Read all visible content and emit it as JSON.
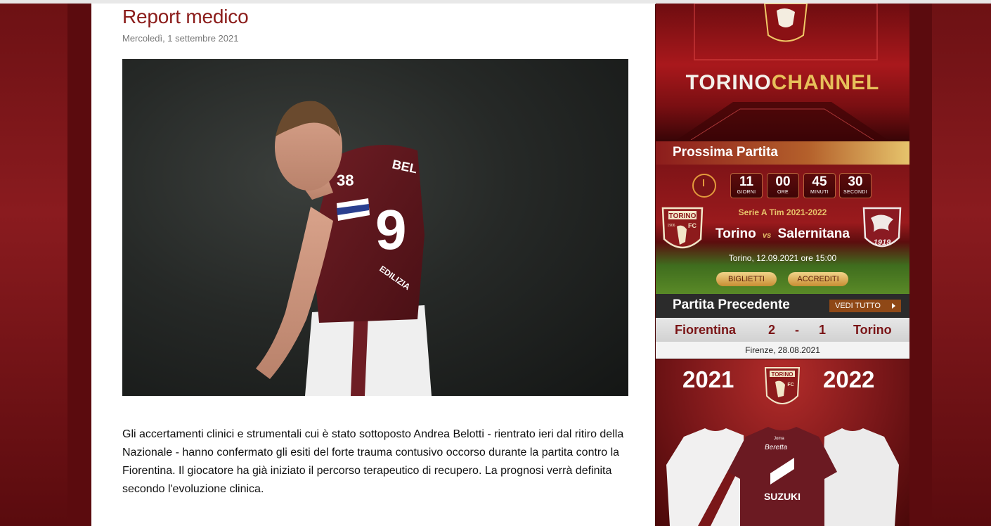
{
  "article": {
    "title": "Report medico",
    "date": "Mercoledì, 1 settembre 2021",
    "body": "Gli accertamenti clinici e strumentali cui è stato sottoposto Andrea Belotti - rientrato ieri dal ritiro della Nazionale - hanno confermato gli esiti del forte trauma contusivo occorso durante la partita contro la Fiorentina. Il giocatore ha già iniziato il percorso terapeutico di recupero. La prognosi verrà definita secondo l'evoluzione clinica.",
    "photo_jersey_number": "9",
    "photo_name_text": "BEL",
    "photo_sponsor_text": "38",
    "photo_sleeve_text": "EDILIZIA"
  },
  "banner": {
    "brand_part1": "TORINO",
    "brand_part2": "CHANNEL"
  },
  "next_match": {
    "heading": "Prossima Partita",
    "countdown": [
      {
        "value": "11",
        "label": "GIORNI"
      },
      {
        "value": "00",
        "label": "ORE"
      },
      {
        "value": "45",
        "label": "MINUTI"
      },
      {
        "value": "30",
        "label": "SECONDI"
      }
    ],
    "competition": "Serie A Tim 2021-2022",
    "home": "Torino",
    "vs": "vs",
    "away": "Salernitana",
    "when": "Torino, 12.09.2021 ore 15:00",
    "tickets_label": "BIGLIETTI",
    "accreditation_label": "ACCREDITI",
    "home_crest": {
      "name": "TORINO",
      "year": "1906",
      "letters": "FC"
    },
    "away_crest": {
      "year": "1919"
    }
  },
  "previous_match": {
    "heading": "Partita Precedente",
    "see_all_label": "VEDI TUTTO",
    "home": "Fiorentina",
    "home_score": "2",
    "separator": "-",
    "away_score": "1",
    "away": "Torino",
    "place_date": "Firenze, 28.08.2021"
  },
  "kit_promo": {
    "year_left": "2021",
    "year_right": "2022",
    "crest_name": "TORINO",
    "crest_letters": "FC",
    "sponsor": "SUZUKI",
    "sponsor_2": "Beretta",
    "brand": "Joma"
  },
  "colors": {
    "title": "#8b1c1a",
    "granata": "#7a1416",
    "gold": "#e8c26a"
  }
}
